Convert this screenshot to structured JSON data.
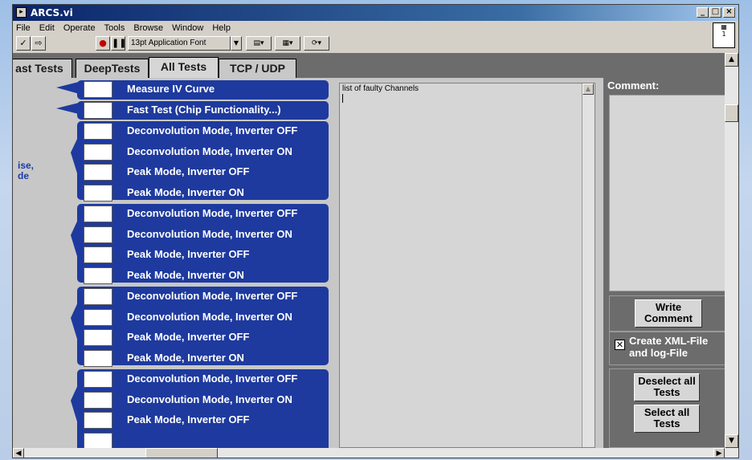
{
  "window": {
    "title": "ARCS.vi",
    "minimize": "_",
    "maximize": "□",
    "close": "×"
  },
  "menu": [
    "File",
    "Edit",
    "Operate",
    "Tools",
    "Browse",
    "Window",
    "Help"
  ],
  "toolbar": {
    "font_selector": "13pt Application Font",
    "vi_icon_label": "1"
  },
  "tabs": [
    {
      "label": "ast Tests"
    },
    {
      "label": "DeepTests"
    },
    {
      "label": "All Tests"
    },
    {
      "label": "TCP / UDP"
    }
  ],
  "active_tab": "All Tests",
  "left_partial_text": [
    "ise,",
    "de"
  ],
  "tests": {
    "measure_iv": "Measure IV Curve",
    "fast_test": "Fast Test (Chip Functionality...)",
    "groups": [
      [
        "Deconvolution Mode, Inverter OFF",
        "Deconvolution Mode, Inverter ON",
        "Peak Mode, Inverter OFF",
        "Peak Mode, Inverter ON"
      ],
      [
        "Deconvolution Mode, Inverter OFF",
        "Deconvolution Mode, Inverter ON",
        "Peak Mode, Inverter OFF",
        "Peak Mode, Inverter ON"
      ],
      [
        "Deconvolution Mode, Inverter OFF",
        "Deconvolution Mode, Inverter ON",
        "Peak Mode, Inverter OFF",
        "Peak Mode, Inverter ON"
      ],
      [
        "Deconvolution Mode, Inverter OFF",
        "Deconvolution Mode, Inverter ON",
        "Peak Mode, Inverter OFF"
      ]
    ]
  },
  "faulty_list": {
    "title": "list of faulty Channels"
  },
  "comment": {
    "label": "Comment:"
  },
  "buttons": {
    "write_comment": "Write Comment",
    "create_xml": "Create XML-File and log-File",
    "deselect_all": "Deselect all Tests",
    "select_all": "Select all Tests"
  },
  "colors": {
    "accent": "#1e3a9e",
    "panel": "#6c6c6c",
    "title_bar": "#0a246a"
  }
}
